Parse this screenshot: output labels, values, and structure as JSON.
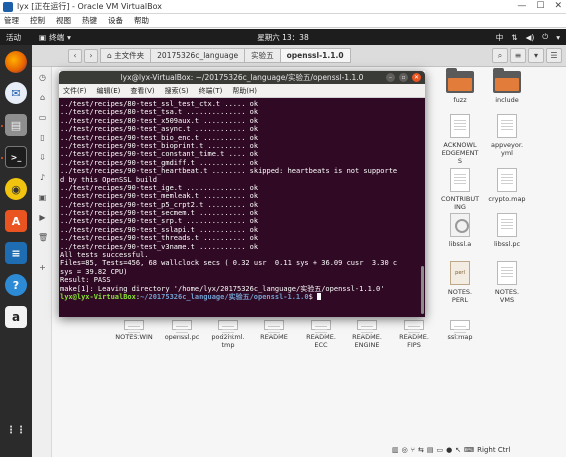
{
  "vbox": {
    "title": "lyx [正在运行] - Oracle VM VirtualBox",
    "menu": [
      "管理",
      "控制",
      "视图",
      "热键",
      "设备",
      "帮助"
    ]
  },
  "topbar": {
    "activities": "活动",
    "app_name": "终端",
    "clock": "星期六 13：38",
    "input_method": "中",
    "right_arrow": "▾"
  },
  "dock": [
    "firefox",
    "thunderbird",
    "files",
    "terminal",
    "rhythmbox",
    "software-center",
    "libreoffice-writer",
    "help",
    "amazon",
    "apps-grid"
  ],
  "files": {
    "crumbs": [
      "主文件夹",
      "20175326c_language",
      "实验五",
      "openssl-1.1.0"
    ],
    "visible_items": [
      {
        "name": "fuzz",
        "kind": "folder"
      },
      {
        "name": "include",
        "kind": "folder"
      },
      {
        "name": "ACKNOWL\nEDGEMENT\nS",
        "kind": "doc"
      },
      {
        "name": "appveyor.\nyml",
        "kind": "doc"
      },
      {
        "name": "CONTRIBUT\nING",
        "kind": "doc"
      },
      {
        "name": "crypto.map",
        "kind": "doc"
      },
      {
        "name": "libssl.a",
        "kind": "lib"
      },
      {
        "name": "libssl.pc",
        "kind": "doc"
      },
      {
        "name": "NOTES.\nPERL",
        "kind": "perl"
      },
      {
        "name": "NOTES.\nVMS",
        "kind": "doc"
      },
      {
        "name": "NOTES.WIN",
        "kind": "doc"
      },
      {
        "name": "openssl.pc",
        "kind": "doc"
      },
      {
        "name": "pod2html.\ntmp",
        "kind": "doc"
      },
      {
        "name": "README",
        "kind": "doc"
      },
      {
        "name": "README.\nECC",
        "kind": "doc"
      },
      {
        "name": "README.\nENGINE",
        "kind": "doc"
      },
      {
        "name": "README.\nFIPS",
        "kind": "doc"
      },
      {
        "name": "ssl.map",
        "kind": "doc"
      }
    ]
  },
  "terminal": {
    "title": "lyx@lyx-VirtualBox: ~/20175326c_language/实验五/openssl-1.1.0",
    "menu": [
      "文件(F)",
      "编辑(E)",
      "查看(V)",
      "搜索(S)",
      "终端(T)",
      "帮助(H)"
    ],
    "lines": [
      "../test/recipes/80-test_ssl_test_ctx.t ..... ok",
      "../test/recipes/80-test_tsa.t .............. ok",
      "../test/recipes/80-test_x509aux.t .......... ok",
      "../test/recipes/90-test_async.t ............ ok",
      "../test/recipes/90-test_bio_enc.t .......... ok",
      "../test/recipes/90-test_bioprint.t ......... ok",
      "../test/recipes/90-test_constant_time.t .... ok",
      "../test/recipes/90-test_gmdiff.t ........... ok",
      "../test/recipes/90-test_heartbeat.t ........ skipped: heartbeats is not supporte",
      "d by this OpenSSL build",
      "../test/recipes/90-test_ige.t .............. ok",
      "../test/recipes/90-test_memleak.t .......... ok",
      "../test/recipes/90-test_p5_crpt2.t ......... ok",
      "../test/recipes/90-test_secmem.t ........... ok",
      "../test/recipes/90-test_srp.t .............. ok",
      "../test/recipes/90-test_sslapi.t ........... ok",
      "../test/recipes/90-test_threads.t .......... ok",
      "../test/recipes/90-test_v3name.t ........... ok",
      "All tests successful.",
      "Files=85, Tests=456, 68 wallclock secs ( 0.32 usr  0.11 sys + 36.09 cusr  3.30 c",
      "sys = 39.82 CPU)",
      "Result: PASS",
      "make[1]: Leaving directory '/home/lyx/20175326c_language/实验五/openssl-1.1.0'"
    ],
    "prompt_user": "lyx@lyx-VirtualBox",
    "prompt_sep": ":",
    "prompt_path": "~/20175326c_language/实验五/openssl-1.1.0",
    "prompt_end": "$ "
  },
  "statusbar": {
    "right_ctrl": "Right Ctrl"
  }
}
